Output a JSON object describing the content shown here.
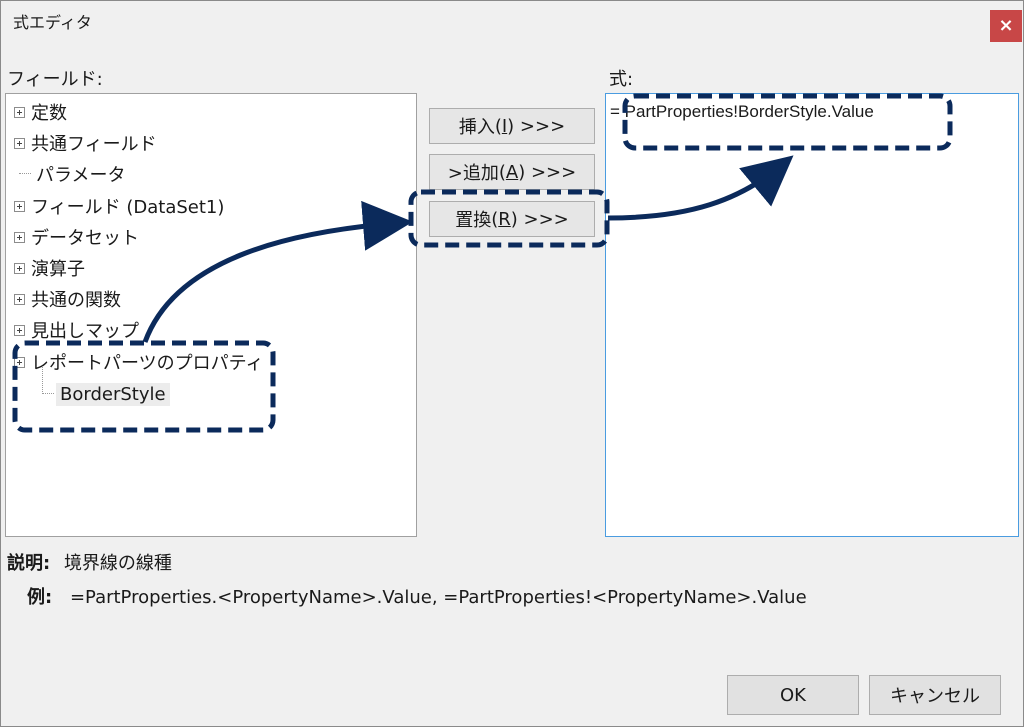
{
  "window": {
    "title": "式エディタ",
    "close_label": "×"
  },
  "fields": {
    "label": "フィールド:",
    "tree": [
      {
        "label": "定数",
        "expandable": true
      },
      {
        "label": "共通フィールド",
        "expandable": true
      },
      {
        "label": "パラメータ",
        "expandable": false
      },
      {
        "label": "フィールド (DataSet1)",
        "expandable": true
      },
      {
        "label": "データセット",
        "expandable": true
      },
      {
        "label": "演算子",
        "expandable": true
      },
      {
        "label": "共通の関数",
        "expandable": true
      },
      {
        "label": "見出しマップ",
        "expandable": true
      },
      {
        "label": "レポートパーツのプロパティ",
        "expandable": true
      }
    ],
    "child": "BorderStyle"
  },
  "buttons": {
    "insert": {
      "label": "挿入",
      "key": "I",
      "suffix": ">>>"
    },
    "append": {
      "prefix": ">追加",
      "key": "A",
      "suffix": ">>>"
    },
    "replace": {
      "label": "置換",
      "key": "R",
      "suffix": ">>>"
    }
  },
  "expression": {
    "label": "式:",
    "value": "= PartProperties!BorderStyle.Value"
  },
  "description": {
    "desc_key": "説明:",
    "desc_value": "境界線の線種",
    "example_key": "例:",
    "example_value": "=PartProperties.<PropertyName>.Value, =PartProperties!<PropertyName>.Value"
  },
  "footer": {
    "ok": "OK",
    "cancel": "キャンセル"
  },
  "colors": {
    "annotation": "#0b2a5b",
    "close_bg": "#c84747",
    "focus_border": "#4a9ce0"
  }
}
